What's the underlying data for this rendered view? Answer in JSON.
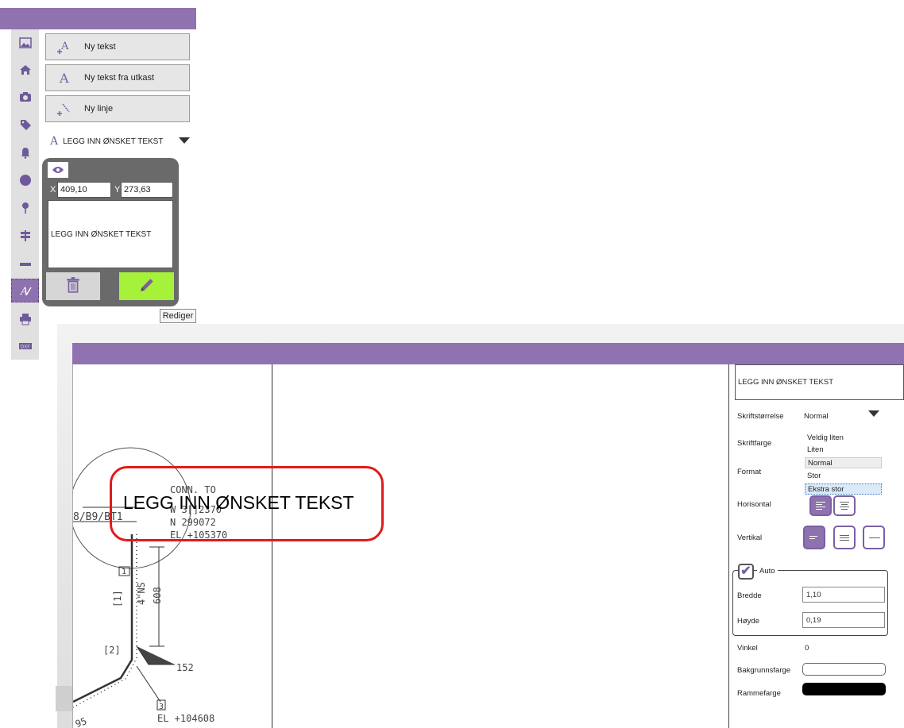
{
  "left_panel": {
    "tools": {
      "new_text": "Ny tekst",
      "new_text_from_draft": "Ny tekst fra utkast",
      "new_line": "Ny linje"
    },
    "text_selector": {
      "value": "LEGG INN ØNSKET TEKST"
    },
    "editor": {
      "x_label": "X",
      "x_value": "409,10",
      "y_label": "Y",
      "y_value": "273,63",
      "text": "LEGG INN ØNSKET TEKST"
    },
    "tooltip": "Rediger",
    "sidebar_icons": [
      "image-icon",
      "home-icon",
      "camera-icon",
      "tag-icon",
      "bell-icon",
      "circle-icon",
      "pin-icon",
      "signpost-icon",
      "ruler-icon",
      "text-edit-icon",
      "printer-icon",
      "dxf-icon"
    ]
  },
  "drawing": {
    "selected_text": "LEGG INN ØNSKET TEKST",
    "labels": {
      "conn": "CONN. TO",
      "w": "W 3[]2370",
      "n": "N 299072",
      "el_top": "EL +105370",
      "ref": "8/B9/BT1",
      "marker1": "1",
      "bracket1": "[1]",
      "ns": "4\"NS",
      "dim608": "608",
      "bracket2": "[2]",
      "dim152": "152",
      "marker3": "3",
      "el_bottom": "EL +104608",
      "dim_partial": "95"
    }
  },
  "properties": {
    "text": "LEGG INN ØNSKET TEKST",
    "font_size_label": "Skriftstørrelse",
    "font_size_value": "Normal",
    "font_size_options": [
      "Veldig liten",
      "Liten",
      "Normal",
      "Stor",
      "Ekstra stor"
    ],
    "font_color_label": "Skriftfarge",
    "format_label": "Format",
    "horizontal_label": "Horisontal",
    "vertical_label": "Vertikal",
    "auto_label": "Auto",
    "width_label": "Bredde",
    "width_value": "1,10",
    "height_label": "Høyde",
    "height_value": "0,19",
    "angle_label": "Vinkel",
    "angle_value": "0",
    "bg_color_label": "Bakgrunnsfarge",
    "bg_color": "#ffffff",
    "frame_color_label": "Rammefarge",
    "frame_color": "#000000"
  },
  "colors": {
    "accent": "#9072b0",
    "active_green": "#a6f23a",
    "highlight_red": "#e01b1b"
  }
}
